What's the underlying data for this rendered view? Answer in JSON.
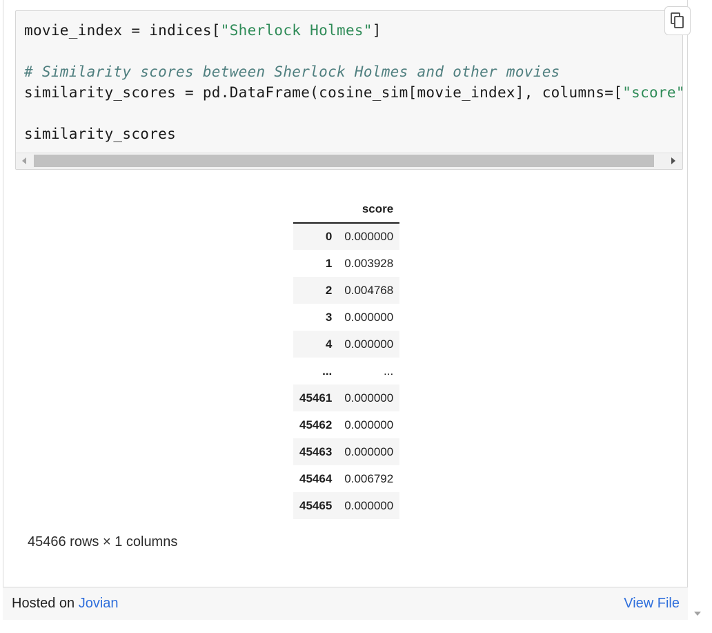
{
  "code": {
    "line1": {
      "pre": "movie_index = indices[",
      "str": "\"Sherlock Holmes\"",
      "post": "]"
    },
    "comment": "# Similarity scores between Sherlock Holmes and other movies",
    "line3": {
      "pre": "similarity_scores = pd.DataFrame(cosine_sim[movie_index], columns=[",
      "str": "\"score\"",
      "post": "])"
    },
    "line4": "similarity_scores"
  },
  "icons": {
    "copy": "copy-icon",
    "scroll_left": "scroll-left-arrow-icon",
    "scroll_right": "scroll-right-arrow-icon",
    "page_scroll_down": "scroll-down-arrow-icon"
  },
  "table": {
    "header_index": "",
    "header_score": "score",
    "rows": [
      {
        "index": "0",
        "score": "0.000000"
      },
      {
        "index": "1",
        "score": "0.003928"
      },
      {
        "index": "2",
        "score": "0.004768"
      },
      {
        "index": "3",
        "score": "0.000000"
      },
      {
        "index": "4",
        "score": "0.000000"
      },
      {
        "index": "...",
        "score": "..."
      },
      {
        "index": "45461",
        "score": "0.000000"
      },
      {
        "index": "45462",
        "score": "0.000000"
      },
      {
        "index": "45463",
        "score": "0.000000"
      },
      {
        "index": "45464",
        "score": "0.006792"
      },
      {
        "index": "45465",
        "score": "0.000000"
      }
    ]
  },
  "shape_text": "45466 rows × 1 columns",
  "footer": {
    "hosted_prefix": "Hosted on ",
    "hosted_link": "Jovian",
    "view_file": "View File"
  },
  "colors": {
    "string_token": "#2e8b57",
    "comment_token": "#4f7f7f",
    "link": "#2f6fdc"
  }
}
